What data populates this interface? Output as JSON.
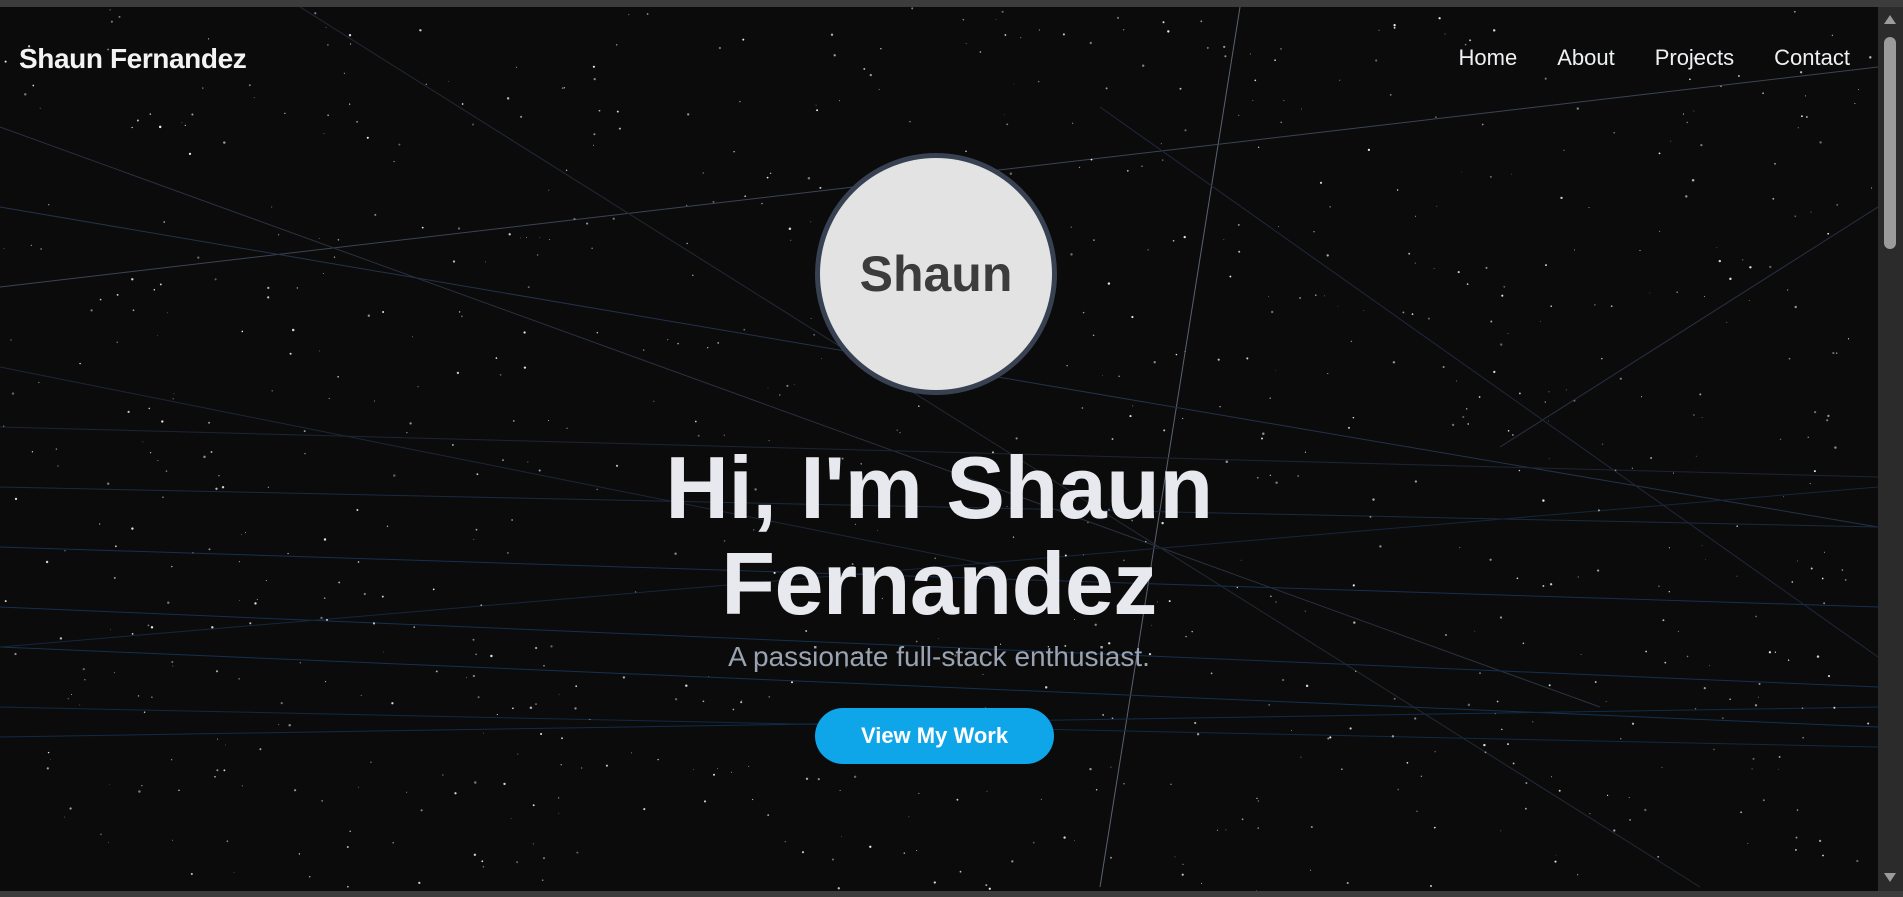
{
  "header": {
    "brand": "Shaun Fernandez",
    "nav": [
      {
        "label": "Home"
      },
      {
        "label": "About"
      },
      {
        "label": "Projects"
      },
      {
        "label": "Contact"
      }
    ]
  },
  "hero": {
    "avatar_text": "Shaun",
    "title_line1": "Hi, I'm Shaun",
    "title_line2": "Fernandez",
    "subtitle": "A passionate full-stack enthusiast.",
    "cta_label": "View My Work"
  },
  "colors": {
    "background": "#0b0b0c",
    "accent": "#0ea5e9",
    "avatar_bg": "#e3e3e3",
    "avatar_border": "#374151",
    "subtitle": "#9aa3b2"
  }
}
